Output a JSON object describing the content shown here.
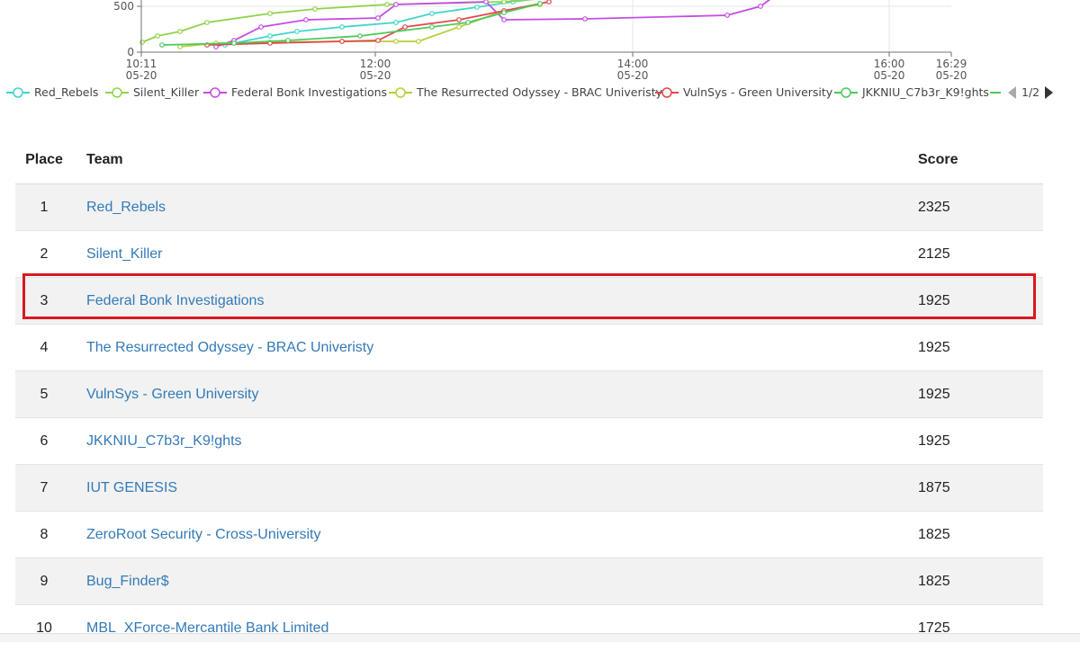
{
  "chart_data": {
    "type": "line",
    "y_ticks": [
      "500",
      "0"
    ],
    "x_ticks": [
      {
        "time": "10:11",
        "date": "05-20"
      },
      {
        "time": "12:00",
        "date": "05-20"
      },
      {
        "time": "14:00",
        "date": "05-20"
      },
      {
        "time": "16:00",
        "date": "05-20"
      },
      {
        "time": "16:29",
        "date": "05-20"
      }
    ],
    "series": [
      {
        "name": "Red_Rebels",
        "color": "#3fd6c7",
        "final_score": 2325
      },
      {
        "name": "Silent_Killer",
        "color": "#8fd34a",
        "final_score": 2125
      },
      {
        "name": "Federal Bonk Investigations",
        "color": "#c44de1",
        "final_score": 1925
      },
      {
        "name": "The Resurrected Odyssey - BRAC Univeristy",
        "color": "#b7cf3a",
        "final_score": 1925
      },
      {
        "name": "VulnSys - Green University",
        "color": "#e0474c",
        "final_score": 1925
      },
      {
        "name": "JKKNIU_C7b3r_K9!ghts",
        "color": "#4cc95a",
        "final_score": 1925
      }
    ],
    "legend_page": "1/2",
    "legend_position": "bottom"
  },
  "table": {
    "headers": {
      "place": "Place",
      "team": "Team",
      "score": "Score"
    },
    "rows": [
      {
        "place": "1",
        "team": "Red_Rebels",
        "score": "2325"
      },
      {
        "place": "2",
        "team": "Silent_Killer",
        "score": "2125"
      },
      {
        "place": "3",
        "team": "Federal Bonk Investigations",
        "score": "1925"
      },
      {
        "place": "4",
        "team": "The Resurrected Odyssey - BRAC Univeristy",
        "score": "1925"
      },
      {
        "place": "5",
        "team": "VulnSys - Green University",
        "score": "1925"
      },
      {
        "place": "6",
        "team": "JKKNIU_C7b3r_K9!ghts",
        "score": "1925"
      },
      {
        "place": "7",
        "team": "IUT GENESIS",
        "score": "1875"
      },
      {
        "place": "8",
        "team": "ZeroRoot Security - Cross-University",
        "score": "1825"
      },
      {
        "place": "9",
        "team": "Bug_Finder$",
        "score": "1825"
      },
      {
        "place": "10",
        "team": "MBL_XForce-Mercantile Bank Limited",
        "score": "1725"
      }
    ]
  },
  "colors": {
    "link": "#337ab7",
    "highlight": "#d9181f"
  }
}
